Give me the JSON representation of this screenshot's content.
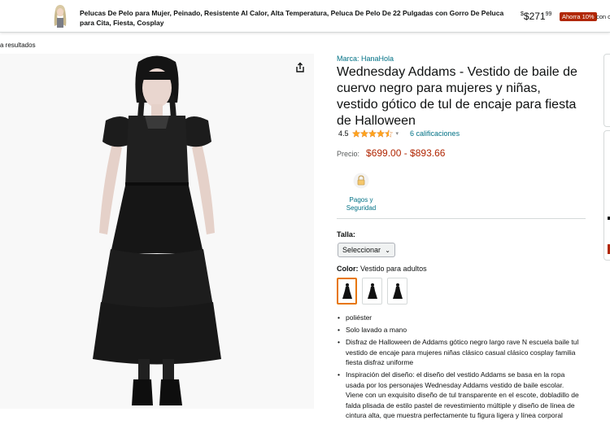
{
  "banner": {
    "title": "Pelucas De Pelo para Mujer, Peinado, Resistente Al Calor, Alta Temperatura, Peluca De Pelo De 22 Pulgadas con Gorro De Peluca para Cita, Fiesta, Cosplay",
    "price_main": "$271",
    "price_cents": "99",
    "badge": "Ahorra 10%",
    "extra": "con c"
  },
  "back_link": "a resultados",
  "product": {
    "brand": "Marca: HanaHola",
    "title": "Wednesday Addams - Vestido de baile de cuervo negro para mujeres y niñas, vestido gótico de tul de encaje para fiesta de Halloween",
    "rating_value": "4.5",
    "rating_stars": 4.5,
    "rating_count": "6 calificaciones",
    "price_label": "Precio:",
    "price_range": "$699.00 - $893.66",
    "payment_label_line1": "Pagos y",
    "payment_label_line2": "Seguridad",
    "size_label": "Talla:",
    "size_select": "Seleccionar",
    "color_label": "Color:",
    "color_value": "Vestido para adultos",
    "bullets": [
      "poliéster",
      "Solo lavado a mano",
      "Disfraz de Halloween de Addams gótico negro largo rave N escuela baile tul vestido de encaje para mujeres niñas clásico casual clásico cosplay familia fiesta disfraz uniforme",
      "Inspiración del diseño: el diseño del vestido Addams se basa en la ropa usada por los personajes Wednesday Addams vestido de baile escolar. Viene con un exquisito diseño de tul transparente en el escote, dobladillo de falda plisada de estilo pastel de revestimiento múltiple y diseño de línea de cintura alta, que muestra perfectamente tu figura ligera y línea corporal"
    ]
  },
  "colors": {
    "link": "#007185",
    "price": "#b12704",
    "selected_swatch": "#e77600",
    "star": "#ffa41c"
  }
}
